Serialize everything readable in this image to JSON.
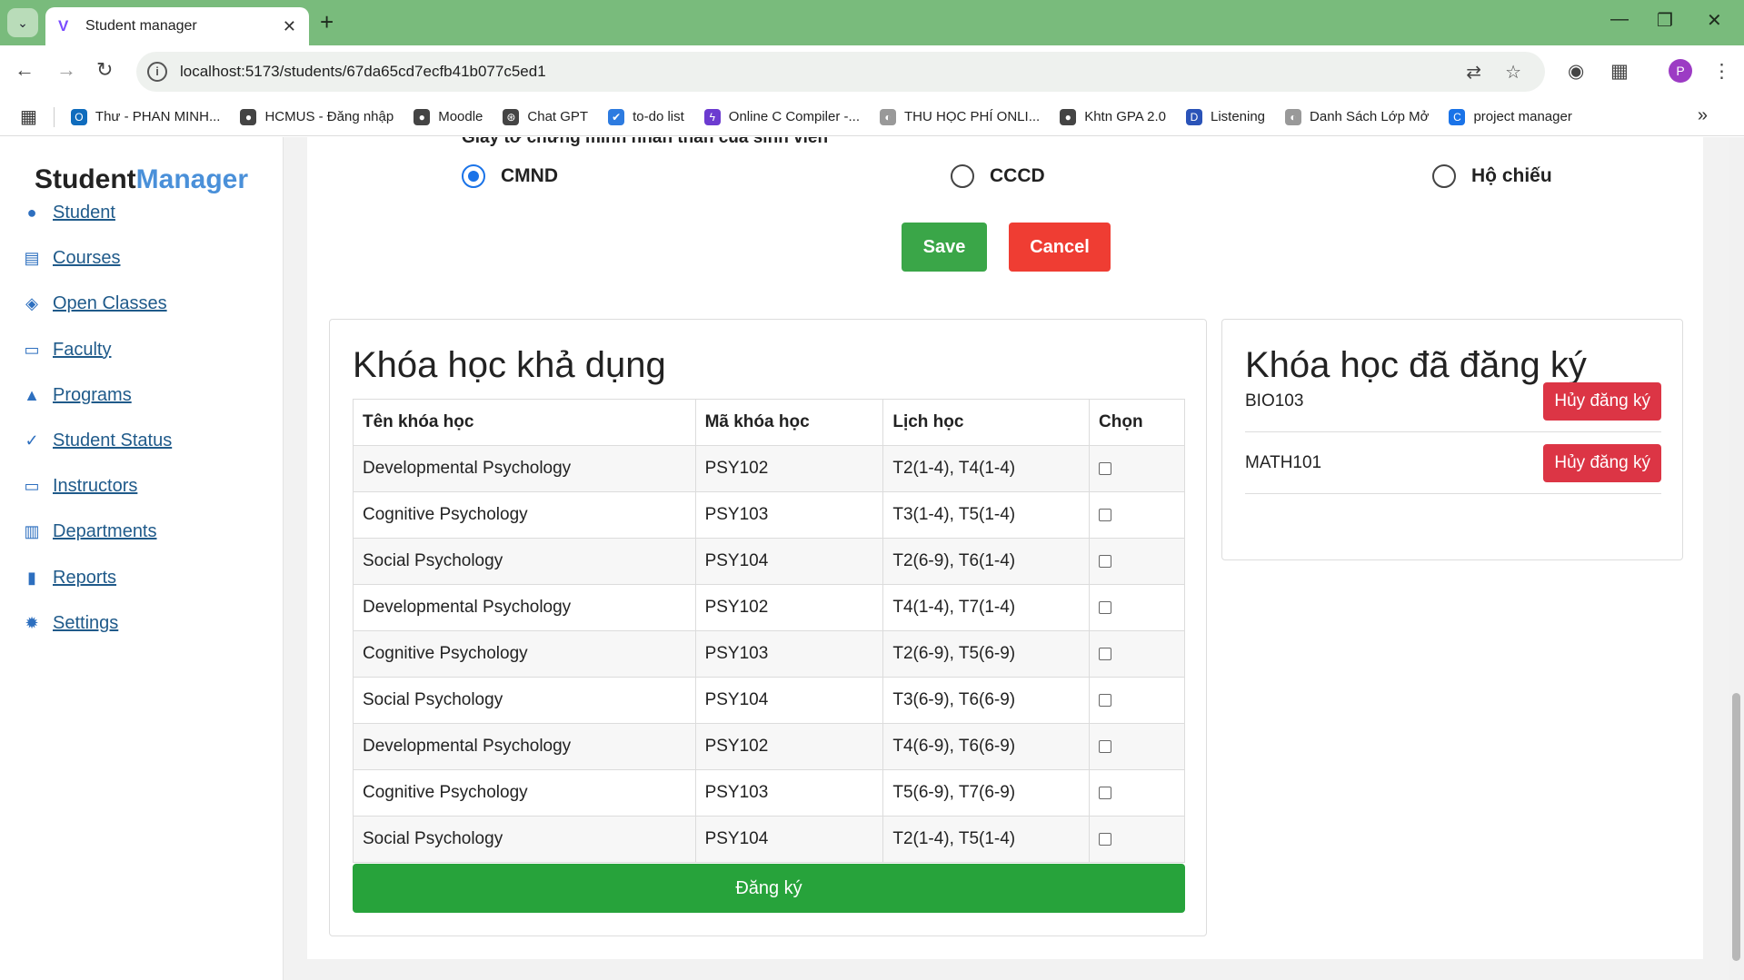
{
  "browser": {
    "tab_title": "Student manager",
    "url": "localhost:5173/students/67da65cd7ecfb41b077c5ed1",
    "profile_initial": "P",
    "bookmarks": [
      {
        "label": "Thư - PHAN MINH...",
        "icon": "outlook-icon",
        "color": "#0f6cbd"
      },
      {
        "label": "HCMUS - Đăng nhập",
        "icon": "globe-icon",
        "color": "#444444"
      },
      {
        "label": "Moodle",
        "icon": "globe-icon",
        "color": "#444444"
      },
      {
        "label": "Chat GPT",
        "icon": "chatgpt-icon",
        "color": "#444444"
      },
      {
        "label": "to-do list",
        "icon": "check-icon",
        "color": "#2d7be0"
      },
      {
        "label": "Online C Compiler -...",
        "icon": "bolt-icon",
        "color": "#6c3bd0"
      },
      {
        "label": "THU HỌC PHÍ ONLI...",
        "icon": "page-icon",
        "color": "#999999"
      },
      {
        "label": "Khtn GPA 2.0",
        "icon": "globe-icon",
        "color": "#444444"
      },
      {
        "label": "Listening",
        "icon": "d-icon",
        "color": "#2a53b8"
      },
      {
        "label": "Danh Sách Lớp Mở",
        "icon": "page-icon",
        "color": "#999999"
      },
      {
        "label": "project manager",
        "icon": "c-icon",
        "color": "#1a73e8"
      }
    ]
  },
  "brand": {
    "part1": "Student",
    "part2": "Manager"
  },
  "sidebar": {
    "items": [
      {
        "label": "Student",
        "icon": "user-icon"
      },
      {
        "label": "Courses",
        "icon": "book-icon"
      },
      {
        "label": "Open Classes",
        "icon": "layers-icon"
      },
      {
        "label": "Faculty",
        "icon": "chalkboard-icon"
      },
      {
        "label": "Programs",
        "icon": "graduation-cap-icon"
      },
      {
        "label": "Student Status",
        "icon": "user-check-icon"
      },
      {
        "label": "Instructors",
        "icon": "chalkboard-teacher-icon"
      },
      {
        "label": "Departments",
        "icon": "building-icon"
      },
      {
        "label": "Reports",
        "icon": "chart-icon"
      },
      {
        "label": "Settings",
        "icon": "gear-icon"
      }
    ]
  },
  "form": {
    "clipped_heading": "Giấy tờ chứng minh nhân thân của sinh viên",
    "id_types": [
      {
        "label": "CMND",
        "checked": true
      },
      {
        "label": "CCCD",
        "checked": false
      },
      {
        "label": "Hộ chiếu",
        "checked": false
      }
    ],
    "save_label": "Save",
    "cancel_label": "Cancel"
  },
  "available": {
    "title": "Khóa học khả dụng",
    "columns": [
      "Tên khóa học",
      "Mã khóa học",
      "Lịch học",
      "Chọn"
    ],
    "rows": [
      {
        "name": "Developmental Psychology",
        "code": "PSY102",
        "schedule": "T2(1-4), T4(1-4)"
      },
      {
        "name": "Cognitive Psychology",
        "code": "PSY103",
        "schedule": "T3(1-4), T5(1-4)"
      },
      {
        "name": "Social Psychology",
        "code": "PSY104",
        "schedule": "T2(6-9), T6(1-4)"
      },
      {
        "name": "Developmental Psychology",
        "code": "PSY102",
        "schedule": "T4(1-4), T7(1-4)"
      },
      {
        "name": "Cognitive Psychology",
        "code": "PSY103",
        "schedule": "T2(6-9), T5(6-9)"
      },
      {
        "name": "Social Psychology",
        "code": "PSY104",
        "schedule": "T3(6-9), T6(6-9)"
      },
      {
        "name": "Developmental Psychology",
        "code": "PSY102",
        "schedule": "T4(6-9), T6(6-9)"
      },
      {
        "name": "Cognitive Psychology",
        "code": "PSY103",
        "schedule": "T5(6-9), T7(6-9)"
      },
      {
        "name": "Social Psychology",
        "code": "PSY104",
        "schedule": "T2(1-4), T5(1-4)"
      }
    ],
    "register_label": "Đăng ký"
  },
  "registered": {
    "title": "Khóa học đã đăng ký",
    "items": [
      {
        "code": "BIO103",
        "action": "Hủy đăng ký"
      },
      {
        "code": "MATH101",
        "action": "Hủy đăng ký"
      }
    ]
  }
}
